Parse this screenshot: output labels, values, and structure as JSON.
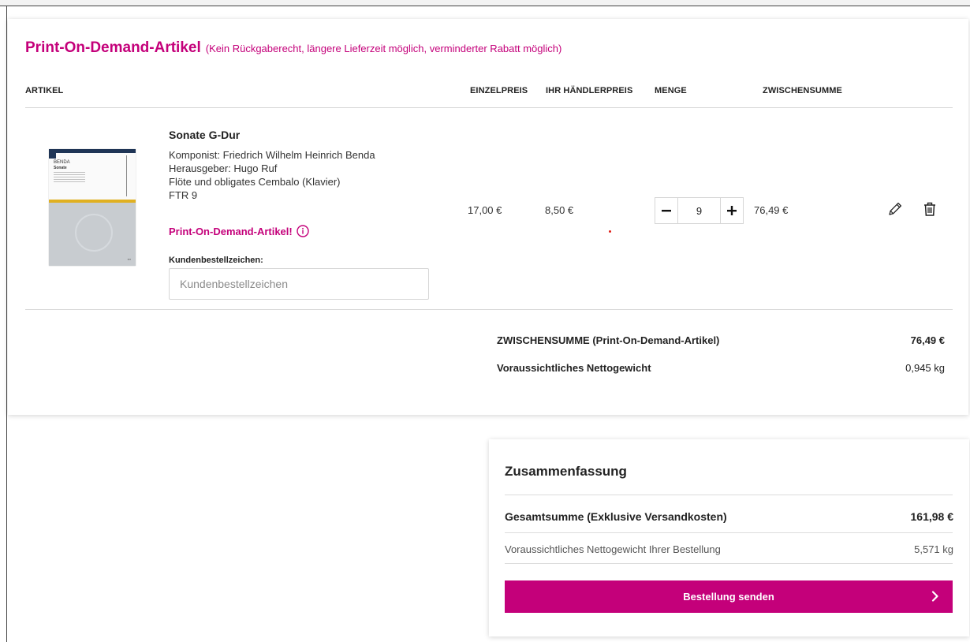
{
  "section": {
    "title": "Print-On-Demand-Artikel",
    "subtitle": "(Kein Rückgaberecht, längere Lieferzeit möglich, verminderter Rabatt möglich)"
  },
  "table_headers": {
    "artikel": "ARTIKEL",
    "einzelpreis": "EINZELPREIS",
    "haendlerpreis": "IHR HÄNDLERPREIS",
    "menge": "MENGE",
    "zwischensumme": "ZWISCHENSUMME"
  },
  "item": {
    "cover_composer": "BENDA",
    "cover_title": "Sonate",
    "title": "Sonate G-Dur",
    "komponist": "Komponist: Friedrich Wilhelm Heinrich Benda",
    "herausgeber": "Herausgeber: Hugo Ruf",
    "besetzung": "Flöte und obligates Cembalo (Klavier)",
    "nummer": "FTR 9",
    "pod_label": "Print-On-Demand-Artikel!",
    "kbz_label": "Kundenbestellzeichen:",
    "kbz_placeholder": "Kundenbestellzeichen",
    "kbz_value": "",
    "einzelpreis": "17,00 €",
    "haendlerpreis": "8,50 €",
    "menge": "9",
    "zwischensumme": "76,49 €"
  },
  "section_totals": {
    "subtotal_label": "ZWISCHENSUMME (Print-On-Demand-Artikel)",
    "subtotal_value": "76,49 €",
    "weight_label": "Voraussichtliches Nettogewicht",
    "weight_value": "0,945 kg"
  },
  "summary": {
    "title": "Zusammenfassung",
    "total_label": "Gesamtsumme (Exklusive Versandkosten)",
    "total_value": "161,98 €",
    "weight_label": "Voraussichtliches Nettogewicht Ihrer Bestellung",
    "weight_value": "5,571 kg",
    "submit_label": "Bestellung senden"
  },
  "colors": {
    "accent": "#c4007a"
  },
  "icons": [
    "info-icon",
    "minus-icon",
    "plus-icon",
    "pencil-icon",
    "trash-icon",
    "chevron-right-icon"
  ]
}
